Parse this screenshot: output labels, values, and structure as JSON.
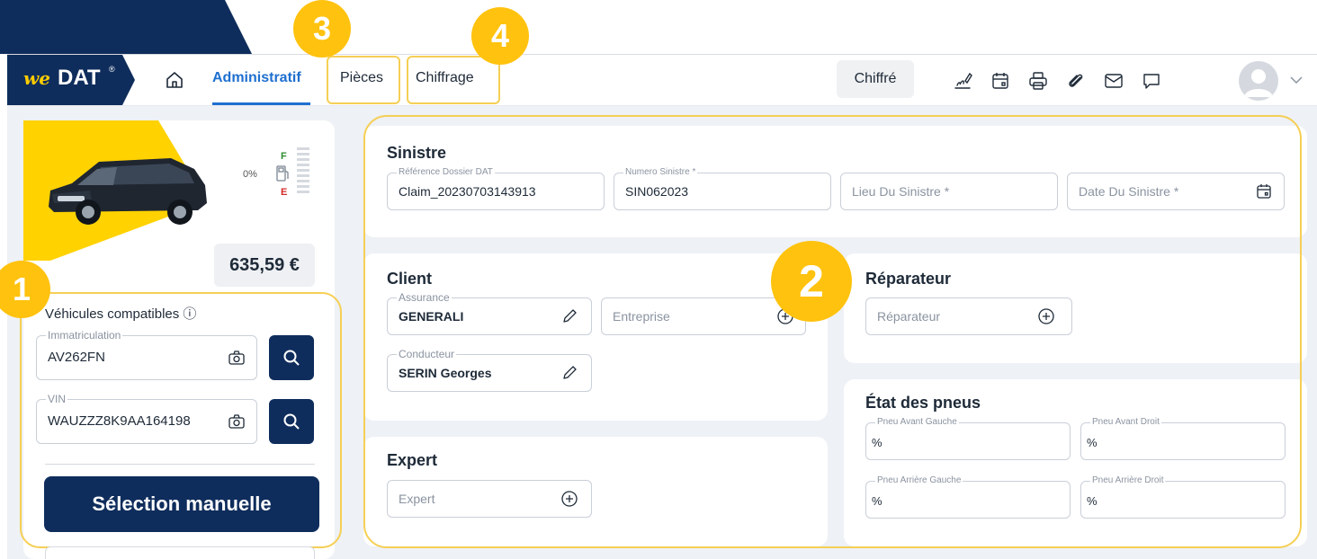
{
  "brand": {
    "we": "we",
    "dat": "DAT",
    "reg": "®"
  },
  "nav": {
    "tabs": [
      {
        "label": "Administratif"
      },
      {
        "label": "Pièces"
      },
      {
        "label": "Chiffrage"
      }
    ],
    "status": "Chiffré"
  },
  "badges": [
    "1",
    "2",
    "3",
    "4"
  ],
  "vehicle": {
    "fuel_pct": "0%",
    "fuel_full": "F",
    "fuel_empty": "E",
    "price": "635,59 €",
    "compatible_label": "Véhicules compatibles ⓘ",
    "immat_label": "Immatriculation",
    "immat_value": "AV262FN",
    "vin_label": "VIN",
    "vin_value": "WAUZZZ8K9AA164198",
    "manual_button": "Sélection manuelle"
  },
  "sinistre": {
    "title": "Sinistre",
    "ref_label": "Référence Dossier DAT",
    "ref_value": "Claim_20230703143913",
    "num_label": "Numero Sinistre *",
    "num_value": "SIN062023",
    "lieu_placeholder": "Lieu Du Sinistre *",
    "date_placeholder": "Date Du Sinistre *"
  },
  "client": {
    "title": "Client",
    "assurance_label": "Assurance",
    "assurance_value": "GENERALI",
    "entreprise_placeholder": "Entreprise",
    "conducteur_label": "Conducteur",
    "conducteur_value": "SERIN Georges"
  },
  "reparateur": {
    "title": "Réparateur",
    "placeholder": "Réparateur"
  },
  "expert": {
    "title": "Expert",
    "placeholder": "Expert"
  },
  "pneus": {
    "title": "État des pneus",
    "avg_label": "Pneu Avant Gauche",
    "avd_label": "Pneu Avant Droit",
    "arg_label": "Pneu Arrière Gauche",
    "ard_label": "Pneu Arrière Droit",
    "unit": "%"
  },
  "colors": {
    "navy": "#0f2d5c",
    "accent_blue": "#1e6fd0",
    "highlight_yellow": "#ffc20e"
  }
}
